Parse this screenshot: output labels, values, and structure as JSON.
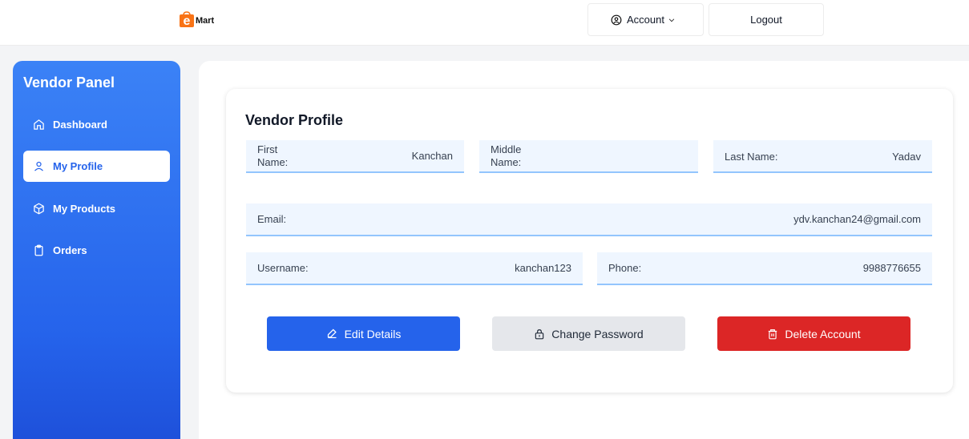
{
  "header": {
    "logo_letter": "e",
    "logo_text": "Mart",
    "account_label": "Account",
    "logout_label": "Logout"
  },
  "sidebar": {
    "title": "Vendor Panel",
    "items": [
      {
        "label": "Dashboard",
        "icon": "home-icon",
        "active": false
      },
      {
        "label": "My Profile",
        "icon": "user-icon",
        "active": true
      },
      {
        "label": "My Products",
        "icon": "box-icon",
        "active": false
      },
      {
        "label": "Orders",
        "icon": "clipboard-icon",
        "active": false
      }
    ]
  },
  "profile": {
    "title": "Vendor Profile",
    "fields": {
      "first_name": {
        "label": "First Name:",
        "value": "Kanchan"
      },
      "middle_name": {
        "label": "Middle Name:",
        "value": ""
      },
      "last_name": {
        "label": "Last Name:",
        "value": "Yadav"
      },
      "email": {
        "label": "Email:",
        "value": "ydv.kanchan24@gmail.com"
      },
      "username": {
        "label": "Username:",
        "value": "kanchan123"
      },
      "phone": {
        "label": "Phone:",
        "value": "9988776655"
      }
    },
    "buttons": {
      "edit": "Edit Details",
      "change_password": "Change Password",
      "delete": "Delete Account"
    }
  },
  "colors": {
    "primary": "#2563eb",
    "danger": "#dc2626",
    "neutral": "#e5e7eb",
    "field_bg": "#eff6ff",
    "logo": "#f97316"
  }
}
